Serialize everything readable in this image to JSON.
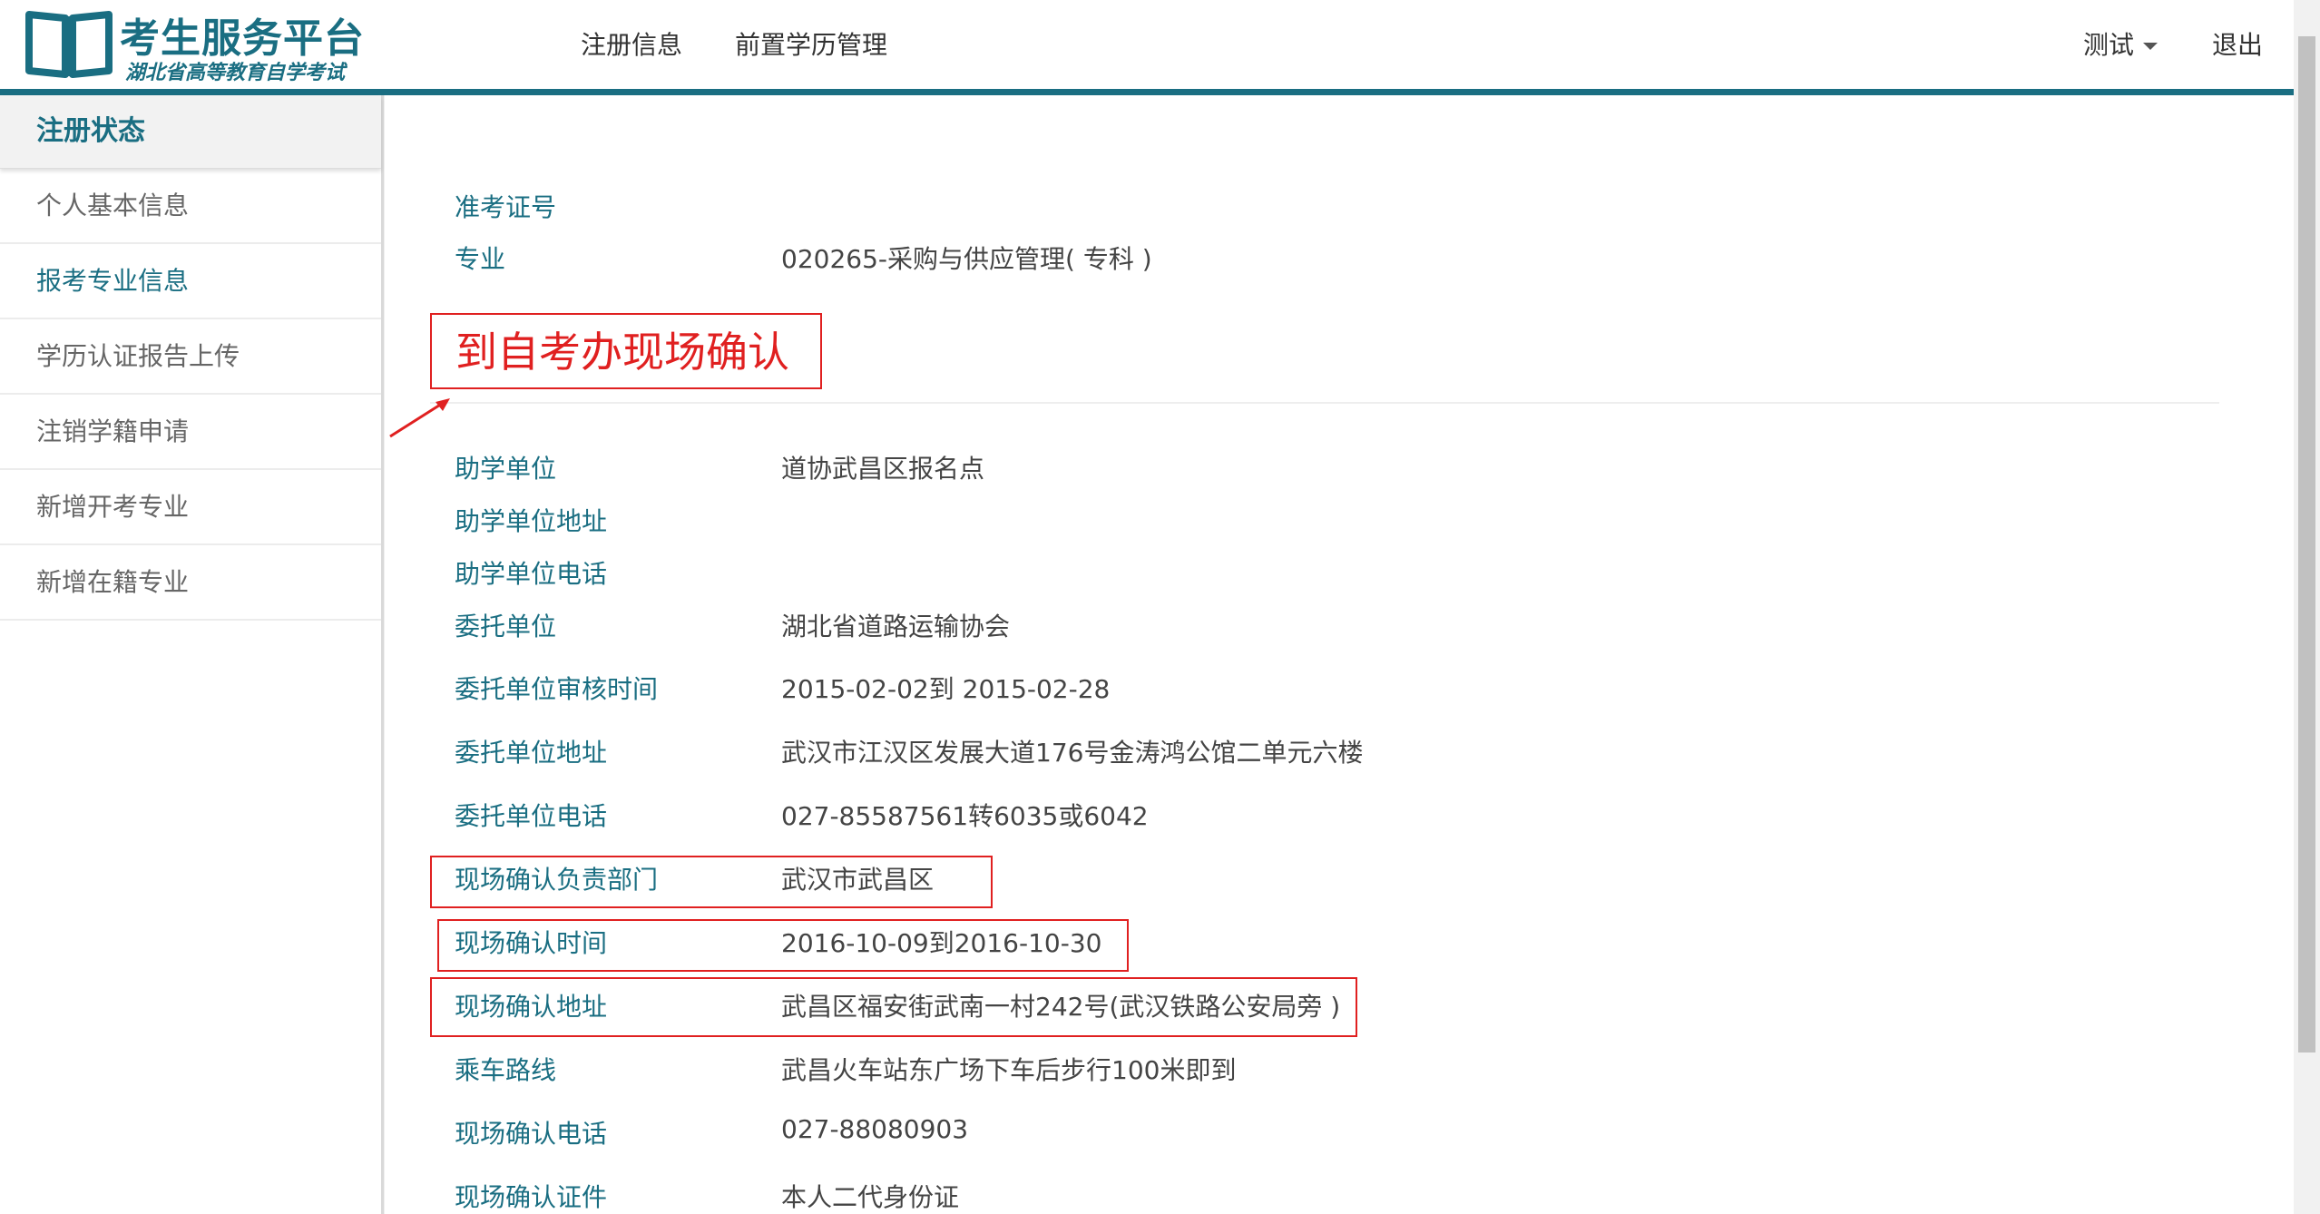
{
  "header": {
    "logo_title": "考生服务平台",
    "logo_subtitle": "湖北省高等教育自学考试",
    "nav": [
      "注册信息",
      "前置学历管理"
    ],
    "user": "测试",
    "logout": "退出",
    "icons": [
      "book-icon",
      "caret-down-icon"
    ]
  },
  "sidebar": {
    "heading": "注册状态",
    "items": [
      {
        "label": "个人基本信息",
        "active": false
      },
      {
        "label": "报考专业信息",
        "active": true
      },
      {
        "label": "学历认证报告上传",
        "active": false
      },
      {
        "label": "注销学籍申请",
        "active": false
      },
      {
        "label": "新增开考专业",
        "active": false
      },
      {
        "label": "新增在籍专业",
        "active": false
      }
    ]
  },
  "main": {
    "top_fields": [
      {
        "label": "准考证号",
        "value": ""
      },
      {
        "label": "专业",
        "value": "020265-采购与供应管理( 专科 )"
      }
    ],
    "notice": "到自考办现场确认",
    "fields": [
      {
        "label": "助学单位",
        "value": "道协武昌区报名点"
      },
      {
        "label": "助学单位地址",
        "value": ""
      },
      {
        "label": "助学单位电话",
        "value": ""
      },
      {
        "label": "委托单位",
        "value": "湖北省道路运输协会"
      },
      {
        "label": "委托单位审核时间",
        "value": "2015-02-02到 2015-02-28"
      },
      {
        "label": "委托单位地址",
        "value": "武汉市江汉区发展大道176号金涛鸿公馆二单元六楼"
      },
      {
        "label": "委托单位电话",
        "value": "027-85587561转6035或6042"
      },
      {
        "label": "现场确认负责部门",
        "value": "武汉市武昌区"
      },
      {
        "label": "现场确认时间",
        "value": "2016-10-09到2016-10-30"
      },
      {
        "label": "现场确认地址",
        "value": "武昌区福安街武南一村242号(武汉铁路公安局旁 )"
      },
      {
        "label": "乘车路线",
        "value": "武昌火车站东广场下车后步行100米即到"
      },
      {
        "label": "现场确认电话",
        "value": "027-88080903"
      },
      {
        "label": "现场确认证件",
        "value": "本人二代身份证"
      }
    ]
  },
  "colors": {
    "accent": "#1a6e82",
    "annotation": "#e02020"
  }
}
